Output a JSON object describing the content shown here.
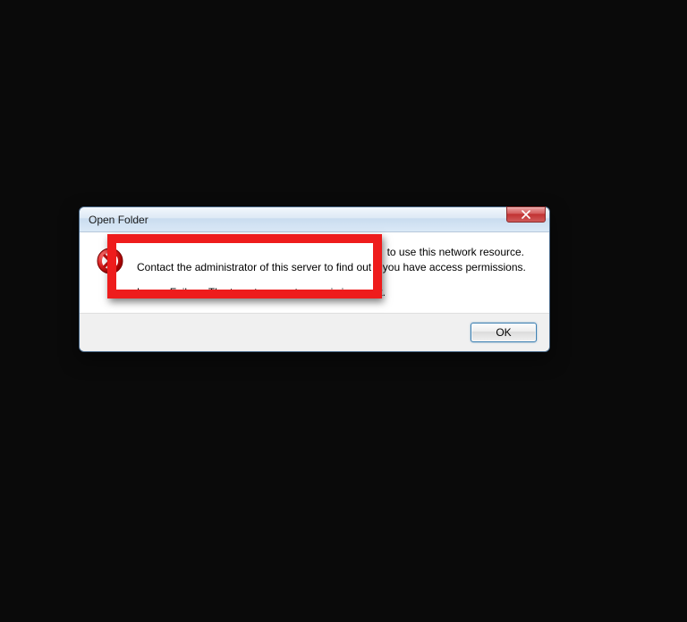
{
  "dialog": {
    "title": "Open Folder",
    "message_line1_suffix": "to use this network resource.",
    "message_line2": "Contact the administrator of this server to find out if you have access permissions.",
    "message_line3": "Logon Failure: The target account name is incorrect.",
    "ok_label": "OK"
  }
}
